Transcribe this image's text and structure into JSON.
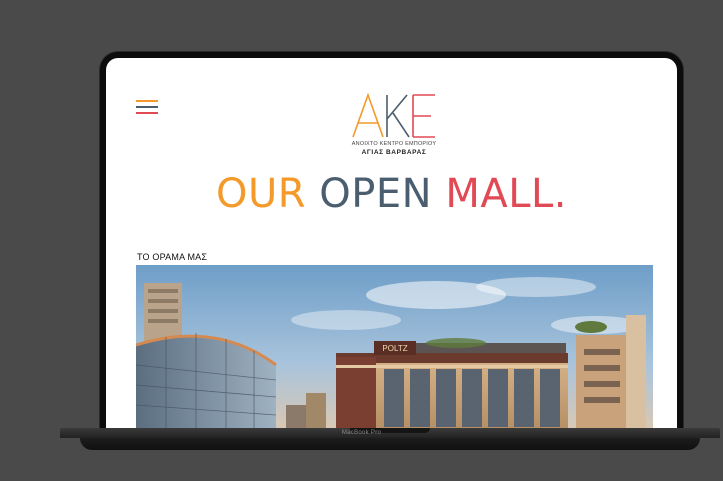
{
  "site": {
    "logo_lettering": "AKE",
    "logo_subtitle": "ΑΝΟΙΧΤΟ ΚΕΝΤΡΟ ΕΜΠΟΡΙΟΥ",
    "logo_title": "ΑΓΙΑΣ ΒΑΡΒΑΡΑΣ",
    "headline": {
      "word1": "OUR",
      "word2": "OPEN",
      "word3": "MALL."
    },
    "section_label": "ΤΟ ΟΡΑΜΑ ΜΑΣ",
    "hero_sign": "POLTZ"
  },
  "device": {
    "label": "MacBook Pro"
  },
  "colors": {
    "orange": "#f39a2a",
    "slate": "#4a5e6f",
    "red": "#e14a55",
    "background": "#4a4a4a"
  },
  "icons": {
    "menu": "hamburger-menu-icon"
  }
}
